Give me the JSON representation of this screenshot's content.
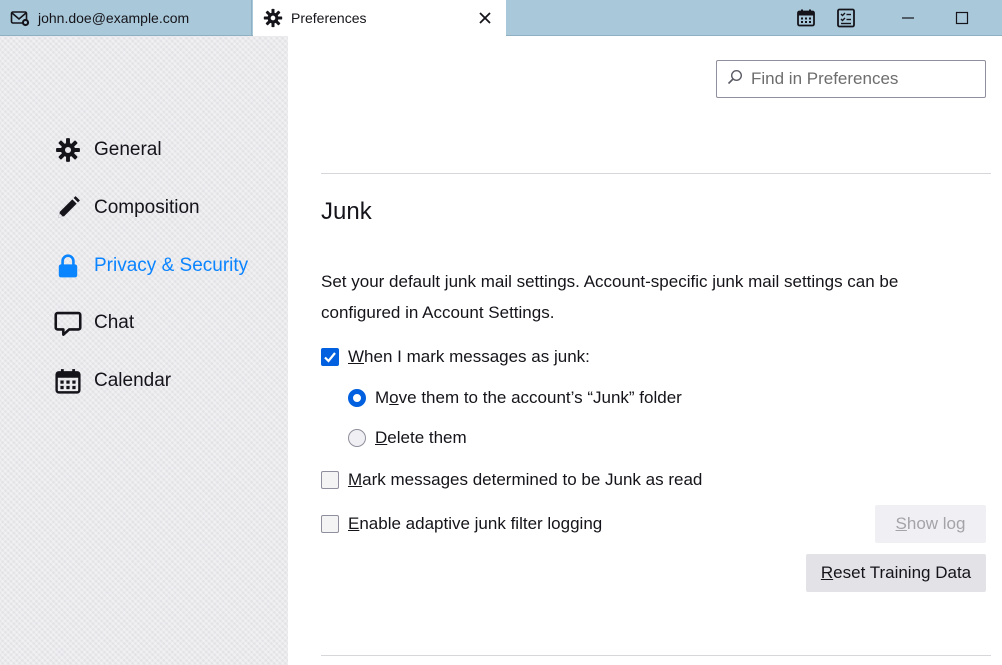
{
  "tabs": {
    "mail": {
      "label": "john.doe@example.com"
    },
    "prefs": {
      "label": "Preferences"
    }
  },
  "sidebar": {
    "items": [
      {
        "label": "General",
        "icon": "gear-icon"
      },
      {
        "label": "Composition",
        "icon": "pencil-icon"
      },
      {
        "label": "Privacy & Security",
        "icon": "lock-icon",
        "selected": true
      },
      {
        "label": "Chat",
        "icon": "chat-icon"
      },
      {
        "label": "Calendar",
        "icon": "calendar-icon"
      }
    ]
  },
  "search": {
    "placeholder": "Find in Preferences",
    "value": ""
  },
  "junk": {
    "title": "Junk",
    "description": "Set your default junk mail settings. Account-specific junk mail settings can be configured in Account Settings.",
    "mark_as_junk": {
      "pre": "",
      "key": "W",
      "post": "hen I mark messages as junk:",
      "checked": true
    },
    "move_option": {
      "pre": "M",
      "key": "o",
      "post": "ve them to the account’s “Junk” folder",
      "selected": true
    },
    "delete_option": {
      "pre": "",
      "key": "D",
      "post": "elete them",
      "selected": false
    },
    "mark_read": {
      "pre": "",
      "key": "M",
      "post": "ark messages determined to be Junk as read",
      "checked": false
    },
    "logging": {
      "pre": "",
      "key": "E",
      "post": "nable adaptive junk filter logging",
      "checked": false
    },
    "show_log": {
      "pre": "",
      "key": "S",
      "post": "how log",
      "disabled": true
    },
    "reset": {
      "pre": "",
      "key": "R",
      "post": "eset Training Data"
    }
  },
  "colors": {
    "accent": "#0060df",
    "selected_category": "#0a84ff",
    "titlebar": "#a9c8d9"
  }
}
